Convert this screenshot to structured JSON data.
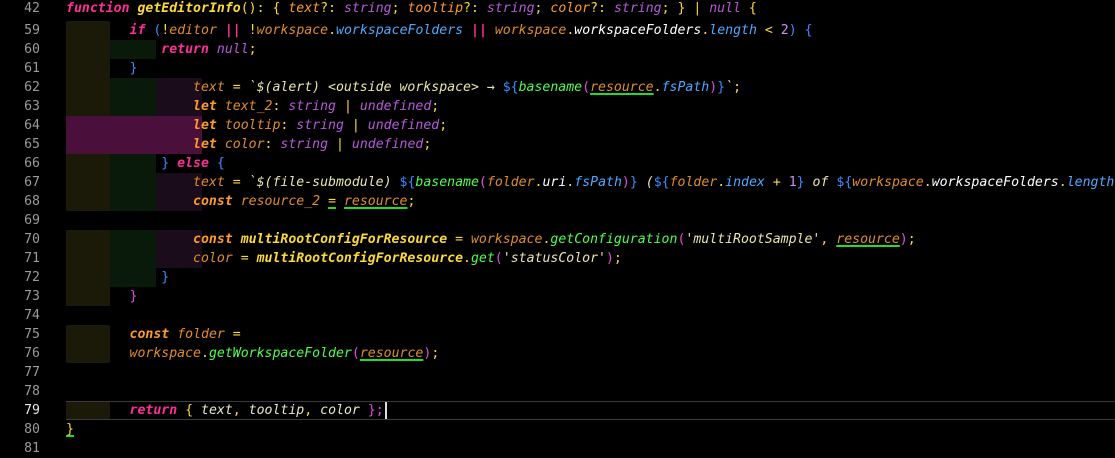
{
  "editor": {
    "current_line": "79",
    "lines": [
      {
        "num": "42",
        "top": 0,
        "blocks": [],
        "tokens": [
          {
            "t": "function",
            "c": "kw"
          },
          {
            "t": " ",
            "c": ""
          },
          {
            "t": "getEditorInfo",
            "c": "fn"
          },
          {
            "t": "(): { ",
            "c": "br"
          },
          {
            "t": "text",
            "c": "pm"
          },
          {
            "t": "?: ",
            "c": "op"
          },
          {
            "t": "string",
            "c": "ty"
          },
          {
            "t": "; ",
            "c": "op"
          },
          {
            "t": "tooltip",
            "c": "pm"
          },
          {
            "t": "?: ",
            "c": "op"
          },
          {
            "t": "string",
            "c": "ty"
          },
          {
            "t": "; ",
            "c": "op"
          },
          {
            "t": "color",
            "c": "pm"
          },
          {
            "t": "?: ",
            "c": "op"
          },
          {
            "t": "string",
            "c": "ty"
          },
          {
            "t": "; } | ",
            "c": "op"
          },
          {
            "t": "null",
            "c": "ty"
          },
          {
            "t": " {",
            "c": "br"
          }
        ]
      },
      {
        "num": "59",
        "blocks": [
          [
            66,
            44,
            "#1b1a08"
          ]
        ],
        "tokens": [
          {
            "t": "        ",
            "c": ""
          },
          {
            "t": "if",
            "c": "kw"
          },
          {
            "t": " (",
            "c": "bb"
          },
          {
            "t": "!",
            "c": "op"
          },
          {
            "t": "editor",
            "c": "vr"
          },
          {
            "t": " || ",
            "c": "kw"
          },
          {
            "t": "!",
            "c": "op"
          },
          {
            "t": "workspace",
            "c": "vr"
          },
          {
            "t": ".",
            "c": "op"
          },
          {
            "t": "workspaceFolders",
            "c": "pr"
          },
          {
            "t": " || ",
            "c": "kw"
          },
          {
            "t": "workspace",
            "c": "vr"
          },
          {
            "t": ".",
            "c": "op"
          },
          {
            "t": "workspaceFolders",
            "c": "pw"
          },
          {
            "t": ".",
            "c": "op"
          },
          {
            "t": "length",
            "c": "pr"
          },
          {
            "t": " < ",
            "c": "op"
          },
          {
            "t": "2",
            "c": "nm"
          },
          {
            "t": ") {",
            "c": "bb"
          }
        ]
      },
      {
        "num": "60",
        "blocks": [
          [
            66,
            44,
            "#1b1a08"
          ],
          [
            110,
            46,
            "#0a1a0a"
          ]
        ],
        "tokens": [
          {
            "t": "            ",
            "c": ""
          },
          {
            "t": "return",
            "c": "kw"
          },
          {
            "t": " ",
            "c": ""
          },
          {
            "t": "null",
            "c": "ty"
          },
          {
            "t": ";",
            "c": "op"
          }
        ]
      },
      {
        "num": "61",
        "blocks": [
          [
            66,
            44,
            "#1b1a08"
          ]
        ],
        "tokens": [
          {
            "t": "        ",
            "c": ""
          },
          {
            "t": "}",
            "c": "bb"
          }
        ]
      },
      {
        "num": "62",
        "blocks": [
          [
            66,
            44,
            "#1b1a08"
          ],
          [
            110,
            46,
            "#0a1a0a"
          ],
          [
            156,
            46,
            "#1a0c1a"
          ]
        ],
        "tokens": [
          {
            "t": "                ",
            "c": ""
          },
          {
            "t": "text",
            "c": "vr"
          },
          {
            "t": " = ",
            "c": "op"
          },
          {
            "t": "`$(alert) <outside workspace> → ",
            "c": "st"
          },
          {
            "t": "${",
            "c": "bb"
          },
          {
            "t": "basename",
            "c": "fg"
          },
          {
            "t": "(",
            "c": "bm"
          },
          {
            "t": "resource",
            "c": "vr",
            "sq": true
          },
          {
            "t": ".",
            "c": "op"
          },
          {
            "t": "fsPath",
            "c": "pr"
          },
          {
            "t": ")",
            "c": "bm"
          },
          {
            "t": "}",
            "c": "bb"
          },
          {
            "t": "`",
            "c": "st"
          },
          {
            "t": ";",
            "c": "op"
          }
        ]
      },
      {
        "num": "63",
        "blocks": [
          [
            66,
            44,
            "#1b1a08"
          ],
          [
            110,
            46,
            "#0a1a0a"
          ],
          [
            156,
            46,
            "#1a0c1a"
          ]
        ],
        "tokens": [
          {
            "t": "                ",
            "c": ""
          },
          {
            "t": "let",
            "c": "kw2"
          },
          {
            "t": " ",
            "c": ""
          },
          {
            "t": "text_2",
            "c": "vr"
          },
          {
            "t": ": ",
            "c": "op"
          },
          {
            "t": "string",
            "c": "ty"
          },
          {
            "t": " | ",
            "c": "op"
          },
          {
            "t": "undefined",
            "c": "ty"
          },
          {
            "t": ";",
            "c": "op"
          }
        ]
      },
      {
        "num": "64",
        "blocks": [
          [
            66,
            136,
            "#4a0f3a"
          ]
        ],
        "tokens": [
          {
            "t": "                ",
            "c": ""
          },
          {
            "t": "let",
            "c": "kw2"
          },
          {
            "t": " ",
            "c": ""
          },
          {
            "t": "tooltip",
            "c": "vr"
          },
          {
            "t": ": ",
            "c": "op"
          },
          {
            "t": "string",
            "c": "ty"
          },
          {
            "t": " | ",
            "c": "op"
          },
          {
            "t": "undefined",
            "c": "ty"
          },
          {
            "t": ";",
            "c": "op"
          }
        ]
      },
      {
        "num": "65",
        "blocks": [
          [
            66,
            136,
            "#4a0f3a"
          ]
        ],
        "tokens": [
          {
            "t": "                ",
            "c": ""
          },
          {
            "t": "let",
            "c": "kw2"
          },
          {
            "t": " ",
            "c": ""
          },
          {
            "t": "color",
            "c": "vr"
          },
          {
            "t": ": ",
            "c": "op"
          },
          {
            "t": "string",
            "c": "ty"
          },
          {
            "t": " | ",
            "c": "op"
          },
          {
            "t": "undefined",
            "c": "ty"
          },
          {
            "t": ";",
            "c": "op"
          }
        ]
      },
      {
        "num": "66",
        "blocks": [
          [
            66,
            44,
            "#1b1a08"
          ],
          [
            110,
            46,
            "#0a1a0a"
          ]
        ],
        "tokens": [
          {
            "t": "            ",
            "c": ""
          },
          {
            "t": "} ",
            "c": "bb"
          },
          {
            "t": "else",
            "c": "kw"
          },
          {
            "t": " {",
            "c": "bb"
          }
        ]
      },
      {
        "num": "67",
        "blocks": [
          [
            66,
            44,
            "#1b1a08"
          ],
          [
            110,
            46,
            "#0a1a0a"
          ],
          [
            156,
            46,
            "#1a0c1a"
          ]
        ],
        "tokens": [
          {
            "t": "                ",
            "c": ""
          },
          {
            "t": "text",
            "c": "vr"
          },
          {
            "t": " = ",
            "c": "op"
          },
          {
            "t": "`$(file-submodule) ",
            "c": "st"
          },
          {
            "t": "${",
            "c": "bb"
          },
          {
            "t": "basename",
            "c": "fg"
          },
          {
            "t": "(",
            "c": "bm"
          },
          {
            "t": "folder",
            "c": "vr"
          },
          {
            "t": ".",
            "c": "op"
          },
          {
            "t": "uri",
            "c": "pw"
          },
          {
            "t": ".",
            "c": "op"
          },
          {
            "t": "fsPath",
            "c": "pr"
          },
          {
            "t": ")",
            "c": "bm"
          },
          {
            "t": "}",
            "c": "bb"
          },
          {
            "t": " (",
            "c": "st"
          },
          {
            "t": "${",
            "c": "bb"
          },
          {
            "t": "folder",
            "c": "vr"
          },
          {
            "t": ".",
            "c": "op"
          },
          {
            "t": "index",
            "c": "pr"
          },
          {
            "t": " + ",
            "c": "op"
          },
          {
            "t": "1",
            "c": "nm"
          },
          {
            "t": "}",
            "c": "bb"
          },
          {
            "t": " of ",
            "c": "st"
          },
          {
            "t": "${",
            "c": "bb"
          },
          {
            "t": "workspace",
            "c": "vr"
          },
          {
            "t": ".",
            "c": "op"
          },
          {
            "t": "workspaceFolders",
            "c": "pw"
          },
          {
            "t": ".",
            "c": "op"
          },
          {
            "t": "length",
            "c": "pr"
          },
          {
            "t": "}",
            "c": "bb"
          },
          {
            "t": ")",
            "c": "st"
          }
        ]
      },
      {
        "num": "68",
        "blocks": [
          [
            66,
            44,
            "#1b1a08"
          ],
          [
            110,
            46,
            "#0a1a0a"
          ],
          [
            156,
            46,
            "#1a0c1a"
          ]
        ],
        "tokens": [
          {
            "t": "                ",
            "c": ""
          },
          {
            "t": "const",
            "c": "kw2"
          },
          {
            "t": " ",
            "c": ""
          },
          {
            "t": "resource_2",
            "c": "vr"
          },
          {
            "t": " ",
            "c": ""
          },
          {
            "t": "=",
            "c": "op",
            "sq": true
          },
          {
            "t": " ",
            "c": ""
          },
          {
            "t": "resource",
            "c": "vr",
            "sq": true
          },
          {
            "t": ";",
            "c": "op"
          }
        ]
      },
      {
        "num": "69",
        "blocks": [],
        "tokens": []
      },
      {
        "num": "70",
        "blocks": [
          [
            66,
            44,
            "#1b1a08"
          ],
          [
            110,
            46,
            "#0a1a0a"
          ],
          [
            156,
            46,
            "#1a0c1a"
          ]
        ],
        "tokens": [
          {
            "t": "                ",
            "c": ""
          },
          {
            "t": "const",
            "c": "kw2"
          },
          {
            "t": " ",
            "c": ""
          },
          {
            "t": "multiRootConfigForResource",
            "c": "fn"
          },
          {
            "t": " = ",
            "c": "op"
          },
          {
            "t": "workspace",
            "c": "vr"
          },
          {
            "t": ".",
            "c": "op"
          },
          {
            "t": "getConfiguration",
            "c": "fg"
          },
          {
            "t": "(",
            "c": "bm"
          },
          {
            "t": "'multiRootSample'",
            "c": "st"
          },
          {
            "t": ", ",
            "c": "op"
          },
          {
            "t": "resource",
            "c": "vr",
            "sq": true
          },
          {
            "t": ")",
            "c": "bm"
          },
          {
            "t": ";",
            "c": "op"
          }
        ]
      },
      {
        "num": "71",
        "blocks": [
          [
            66,
            44,
            "#1b1a08"
          ],
          [
            110,
            46,
            "#0a1a0a"
          ],
          [
            156,
            46,
            "#1a0c1a"
          ]
        ],
        "tokens": [
          {
            "t": "                ",
            "c": ""
          },
          {
            "t": "color",
            "c": "vr"
          },
          {
            "t": " = ",
            "c": "op"
          },
          {
            "t": "multiRootConfigForResource",
            "c": "fn"
          },
          {
            "t": ".",
            "c": "op"
          },
          {
            "t": "get",
            "c": "fg"
          },
          {
            "t": "(",
            "c": "bm"
          },
          {
            "t": "'statusColor'",
            "c": "st"
          },
          {
            "t": ")",
            "c": "bm"
          },
          {
            "t": ";",
            "c": "op"
          }
        ]
      },
      {
        "num": "72",
        "blocks": [
          [
            66,
            44,
            "#1b1a08"
          ],
          [
            110,
            46,
            "#0a1a0a"
          ]
        ],
        "tokens": [
          {
            "t": "            ",
            "c": ""
          },
          {
            "t": "}",
            "c": "bb"
          }
        ]
      },
      {
        "num": "73",
        "blocks": [
          [
            66,
            44,
            "#1b1a08"
          ]
        ],
        "tokens": [
          {
            "t": "        ",
            "c": ""
          },
          {
            "t": "}",
            "c": "bm"
          }
        ]
      },
      {
        "num": "74",
        "blocks": [],
        "tokens": []
      },
      {
        "num": "75",
        "blocks": [
          [
            66,
            44,
            "#1b1a08"
          ]
        ],
        "tokens": [
          {
            "t": "        ",
            "c": ""
          },
          {
            "t": "const",
            "c": "kw2"
          },
          {
            "t": " ",
            "c": ""
          },
          {
            "t": "folder",
            "c": "vr"
          },
          {
            "t": " =",
            "c": "op"
          }
        ]
      },
      {
        "num": "76",
        "blocks": [
          [
            66,
            44,
            "#1b1a08"
          ]
        ],
        "tokens": [
          {
            "t": "        ",
            "c": ""
          },
          {
            "t": "workspace",
            "c": "vr"
          },
          {
            "t": ".",
            "c": "op"
          },
          {
            "t": "getWorkspaceFolder",
            "c": "fg"
          },
          {
            "t": "(",
            "c": "bm"
          },
          {
            "t": "resource",
            "c": "vr",
            "sq": true
          },
          {
            "t": ")",
            "c": "bm"
          },
          {
            "t": ";",
            "c": "op"
          }
        ]
      },
      {
        "num": "77",
        "blocks": [],
        "tokens": []
      },
      {
        "num": "78",
        "blocks": [],
        "tokens": []
      },
      {
        "num": "79",
        "blocks": [
          [
            66,
            44,
            "#1b1a08"
          ]
        ],
        "tokens": [
          {
            "t": "        ",
            "c": ""
          },
          {
            "t": "return",
            "c": "kw"
          },
          {
            "t": " { ",
            "c": "op"
          },
          {
            "t": "text",
            "c": "pl"
          },
          {
            "t": ", ",
            "c": "op"
          },
          {
            "t": "tooltip",
            "c": "pl"
          },
          {
            "t": ", ",
            "c": "op"
          },
          {
            "t": "color",
            "c": "pl"
          },
          {
            "t": " };",
            "c": "bm"
          }
        ]
      },
      {
        "num": "80",
        "blocks": [],
        "tokens": [
          {
            "t": "}",
            "c": "br",
            "sq": true
          }
        ]
      },
      {
        "num": "81",
        "blocks": [],
        "tokens": []
      }
    ]
  }
}
